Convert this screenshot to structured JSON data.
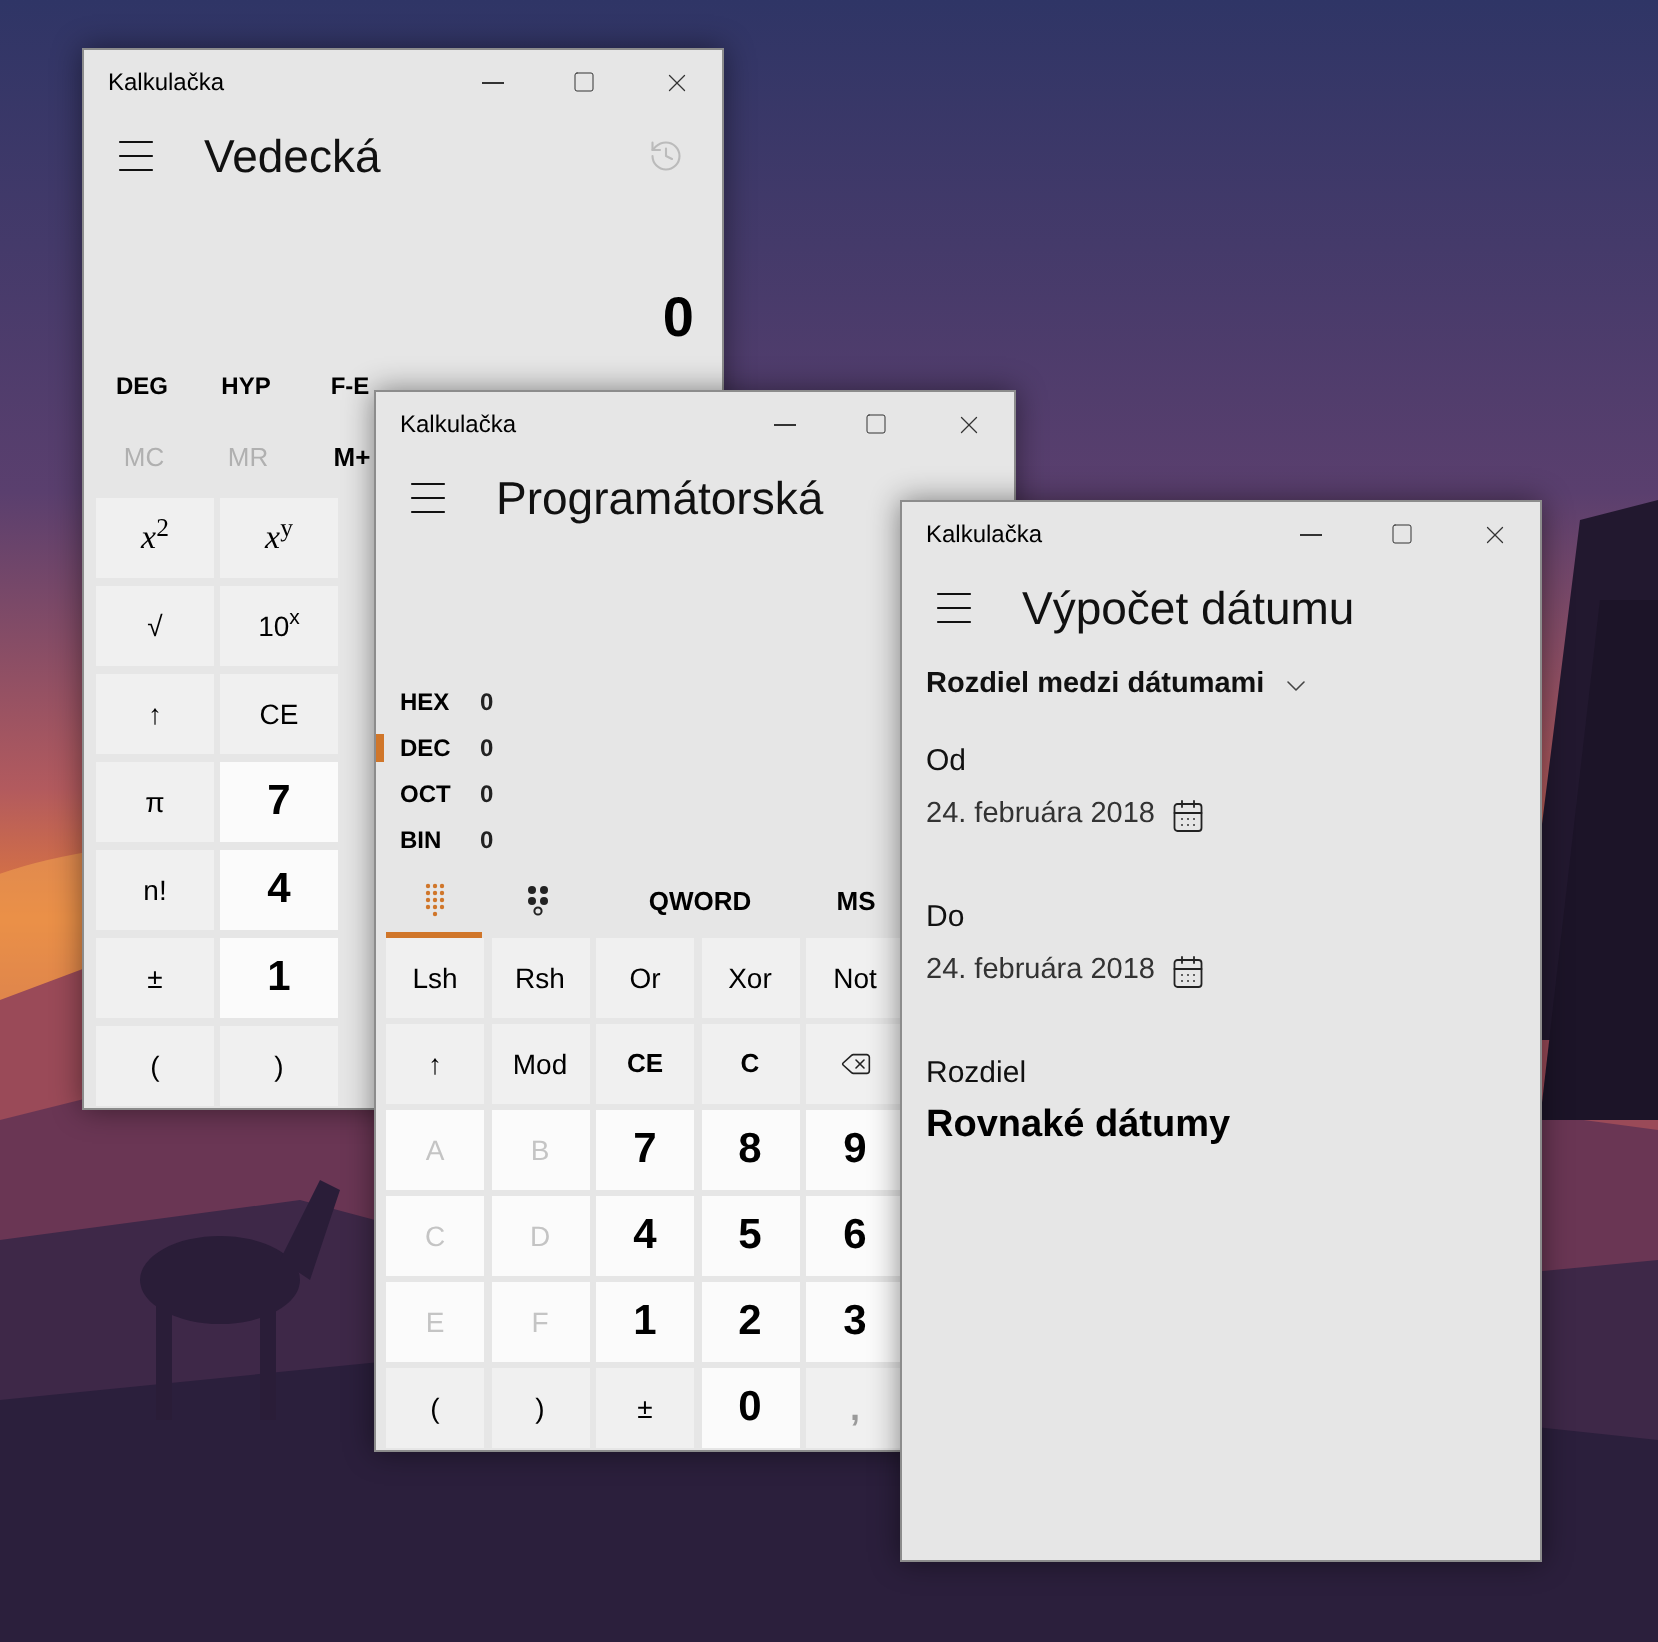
{
  "windows": [
    {
      "kind": "scientific",
      "title": "Kalkulačka",
      "heading": "Vedecká",
      "display": "0",
      "angle_buttons": [
        "DEG",
        "HYP",
        "F-E"
      ],
      "memory": [
        {
          "label": "MC",
          "disabled": true
        },
        {
          "label": "MR",
          "disabled": true
        },
        {
          "label": "M+",
          "disabled": false
        }
      ],
      "keys": [
        {
          "label": "*x*$^{2}$",
          "kind": "formula",
          "disabled": false
        },
        {
          "label": "*x*$^{y}$",
          "kind": "formula",
          "disabled": false
        },
        {
          "label": "√",
          "kind": "function",
          "disabled": false
        },
        {
          "label": "10$^{x}$",
          "kind": "function",
          "disabled": false
        },
        {
          "label": "↑",
          "kind": "function",
          "disabled": false
        },
        {
          "label": "CE",
          "kind": "function",
          "disabled": false
        },
        {
          "label": "π",
          "kind": "function",
          "disabled": false
        },
        {
          "label": "7",
          "kind": "digit",
          "disabled": false
        },
        {
          "label": "n!",
          "kind": "function",
          "disabled": false
        },
        {
          "label": "4",
          "kind": "digit",
          "disabled": false
        },
        {
          "label": "±",
          "kind": "function",
          "disabled": false
        },
        {
          "label": "1",
          "kind": "digit",
          "disabled": false
        },
        {
          "label": "(",
          "kind": "function",
          "disabled": false
        },
        {
          "label": ")",
          "kind": "function",
          "disabled": false
        }
      ]
    },
    {
      "kind": "programmer",
      "title": "Kalkulačka",
      "heading": "Programátorská",
      "radix": [
        {
          "label": "HEX",
          "value": "0",
          "selected": false
        },
        {
          "label": "DEC",
          "value": "0",
          "selected": true
        },
        {
          "label": "OCT",
          "value": "0",
          "selected": false
        },
        {
          "label": "BIN",
          "value": "0",
          "selected": false
        }
      ],
      "tabs": [
        {
          "kind": "keypad",
          "selected": true
        },
        {
          "kind": "bits",
          "selected": false
        }
      ],
      "word_size": "QWORD",
      "memory": "MS",
      "keys": [
        {
          "label": "Lsh",
          "kind": "function",
          "disabled": false
        },
        {
          "label": "Rsh",
          "kind": "function",
          "disabled": false
        },
        {
          "label": "Or",
          "kind": "function",
          "disabled": false
        },
        {
          "label": "Xor",
          "kind": "function",
          "disabled": false
        },
        {
          "label": "Not",
          "kind": "function",
          "disabled": false
        },
        {
          "label": "↑",
          "kind": "function",
          "disabled": false
        },
        {
          "label": "Mod",
          "kind": "function",
          "disabled": false
        },
        {
          "label": "CE",
          "kind": "clear",
          "disabled": false
        },
        {
          "label": "C",
          "kind": "clear",
          "disabled": false
        },
        {
          "kind": "backspace",
          "disabled": false
        },
        {
          "label": "A",
          "kind": "digit",
          "disabled": true
        },
        {
          "label": "B",
          "kind": "digit",
          "disabled": true
        },
        {
          "label": "7",
          "kind": "digit",
          "disabled": false
        },
        {
          "label": "8",
          "kind": "digit",
          "disabled": false
        },
        {
          "label": "9",
          "kind": "digit",
          "disabled": false
        },
        {
          "label": "C",
          "kind": "digit",
          "disabled": true
        },
        {
          "label": "D",
          "kind": "digit",
          "disabled": true
        },
        {
          "label": "4",
          "kind": "digit",
          "disabled": false
        },
        {
          "label": "5",
          "kind": "digit",
          "disabled": false
        },
        {
          "label": "6",
          "kind": "digit",
          "disabled": false
        },
        {
          "label": "E",
          "kind": "digit",
          "disabled": true
        },
        {
          "label": "F",
          "kind": "digit",
          "disabled": true
        },
        {
          "label": "1",
          "kind": "digit",
          "disabled": false
        },
        {
          "label": "2",
          "kind": "digit",
          "disabled": false
        },
        {
          "label": "3",
          "kind": "digit",
          "disabled": false
        },
        {
          "label": "(",
          "kind": "function",
          "disabled": false
        },
        {
          "label": ")",
          "kind": "function",
          "disabled": false
        },
        {
          "label": "±",
          "kind": "function",
          "disabled": false
        },
        {
          "label": "0",
          "kind": "digit",
          "disabled": false
        },
        {
          "label": ",",
          "kind": "function",
          "disabled": true
        }
      ]
    },
    {
      "kind": "date",
      "title": "Kalkulačka",
      "heading": "Výpočet dátumu",
      "mode_dropdown": "Rozdiel medzi dátumami",
      "from": {
        "label": "Od",
        "date": "24. februára 2018"
      },
      "to": {
        "label": "Do",
        "date": "24. februára 2018"
      },
      "result": {
        "label": "Rozdiel",
        "value": "Rovnaké dátumy"
      }
    }
  ]
}
